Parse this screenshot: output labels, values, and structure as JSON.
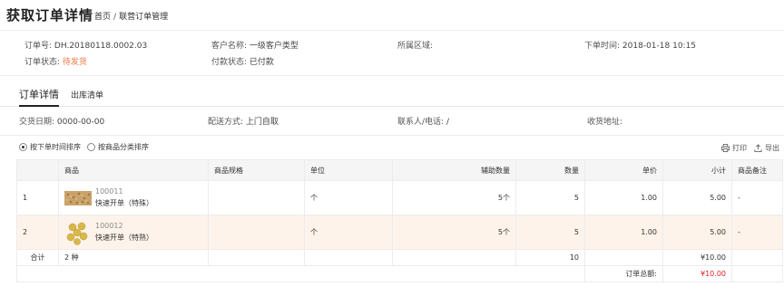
{
  "header": {
    "title": "获取订单详情",
    "breadcrumb": {
      "home": "首页",
      "sep": "/",
      "current": "联营订单管理"
    }
  },
  "order_info": {
    "order_no_label": "订单号:",
    "order_no": "DH.20180118.0002.03",
    "customer_label": "客户名称:",
    "customer": "一级客户类型",
    "region_label": "所属区域:",
    "region": "",
    "order_time_label": "下单时间:",
    "order_time": "2018-01-18 10:15",
    "status_label": "订单状态:",
    "status": "待发货",
    "pay_status_label": "付款状态:",
    "pay_status": "已付款"
  },
  "tabs": [
    {
      "label": "订单详情",
      "active": true
    },
    {
      "label": "出库清单",
      "active": false
    }
  ],
  "delivery": {
    "date_label": "交货日期:",
    "date": "0000-00-00",
    "method_label": "配送方式:",
    "method": "上门自取",
    "contact_label": "联系人/电话:",
    "contact": "/",
    "address_label": "收货地址:",
    "address": ""
  },
  "sort": {
    "by_time": "按下单时间排序",
    "by_category": "按商品分类排序",
    "print": "打印",
    "export": "导出"
  },
  "table": {
    "columns": {
      "product": "商品",
      "spec": "商品规格",
      "unit": "单位",
      "aux_qty": "辅助数量",
      "qty": "数量",
      "price": "单价",
      "subtotal": "小计",
      "remark": "商品备注"
    },
    "rows": [
      {
        "index": "1",
        "code": "100011",
        "name": "快速开单（特殊）",
        "spec": "",
        "unit": "个",
        "aux_qty": "5个",
        "qty": "5",
        "price": "1.00",
        "subtotal": "5.00",
        "remark": "-",
        "thumb": "grain-image"
      },
      {
        "index": "2",
        "code": "100012",
        "name": "快速开单（特熟）",
        "spec": "",
        "unit": "个",
        "aux_qty": "5个",
        "qty": "5",
        "price": "1.00",
        "subtotal": "5.00",
        "remark": "-",
        "thumb": "soybean-image"
      }
    ],
    "summary": {
      "label": "合计",
      "kinds": "2 种",
      "qty": "10",
      "subtotal": "¥10.00"
    },
    "total": {
      "label": "订单总额:",
      "value": "¥10.00"
    }
  },
  "colors": {
    "pending": "#f0784a",
    "total_red": "#e02020",
    "row_highlight": "#fdf3ea"
  }
}
